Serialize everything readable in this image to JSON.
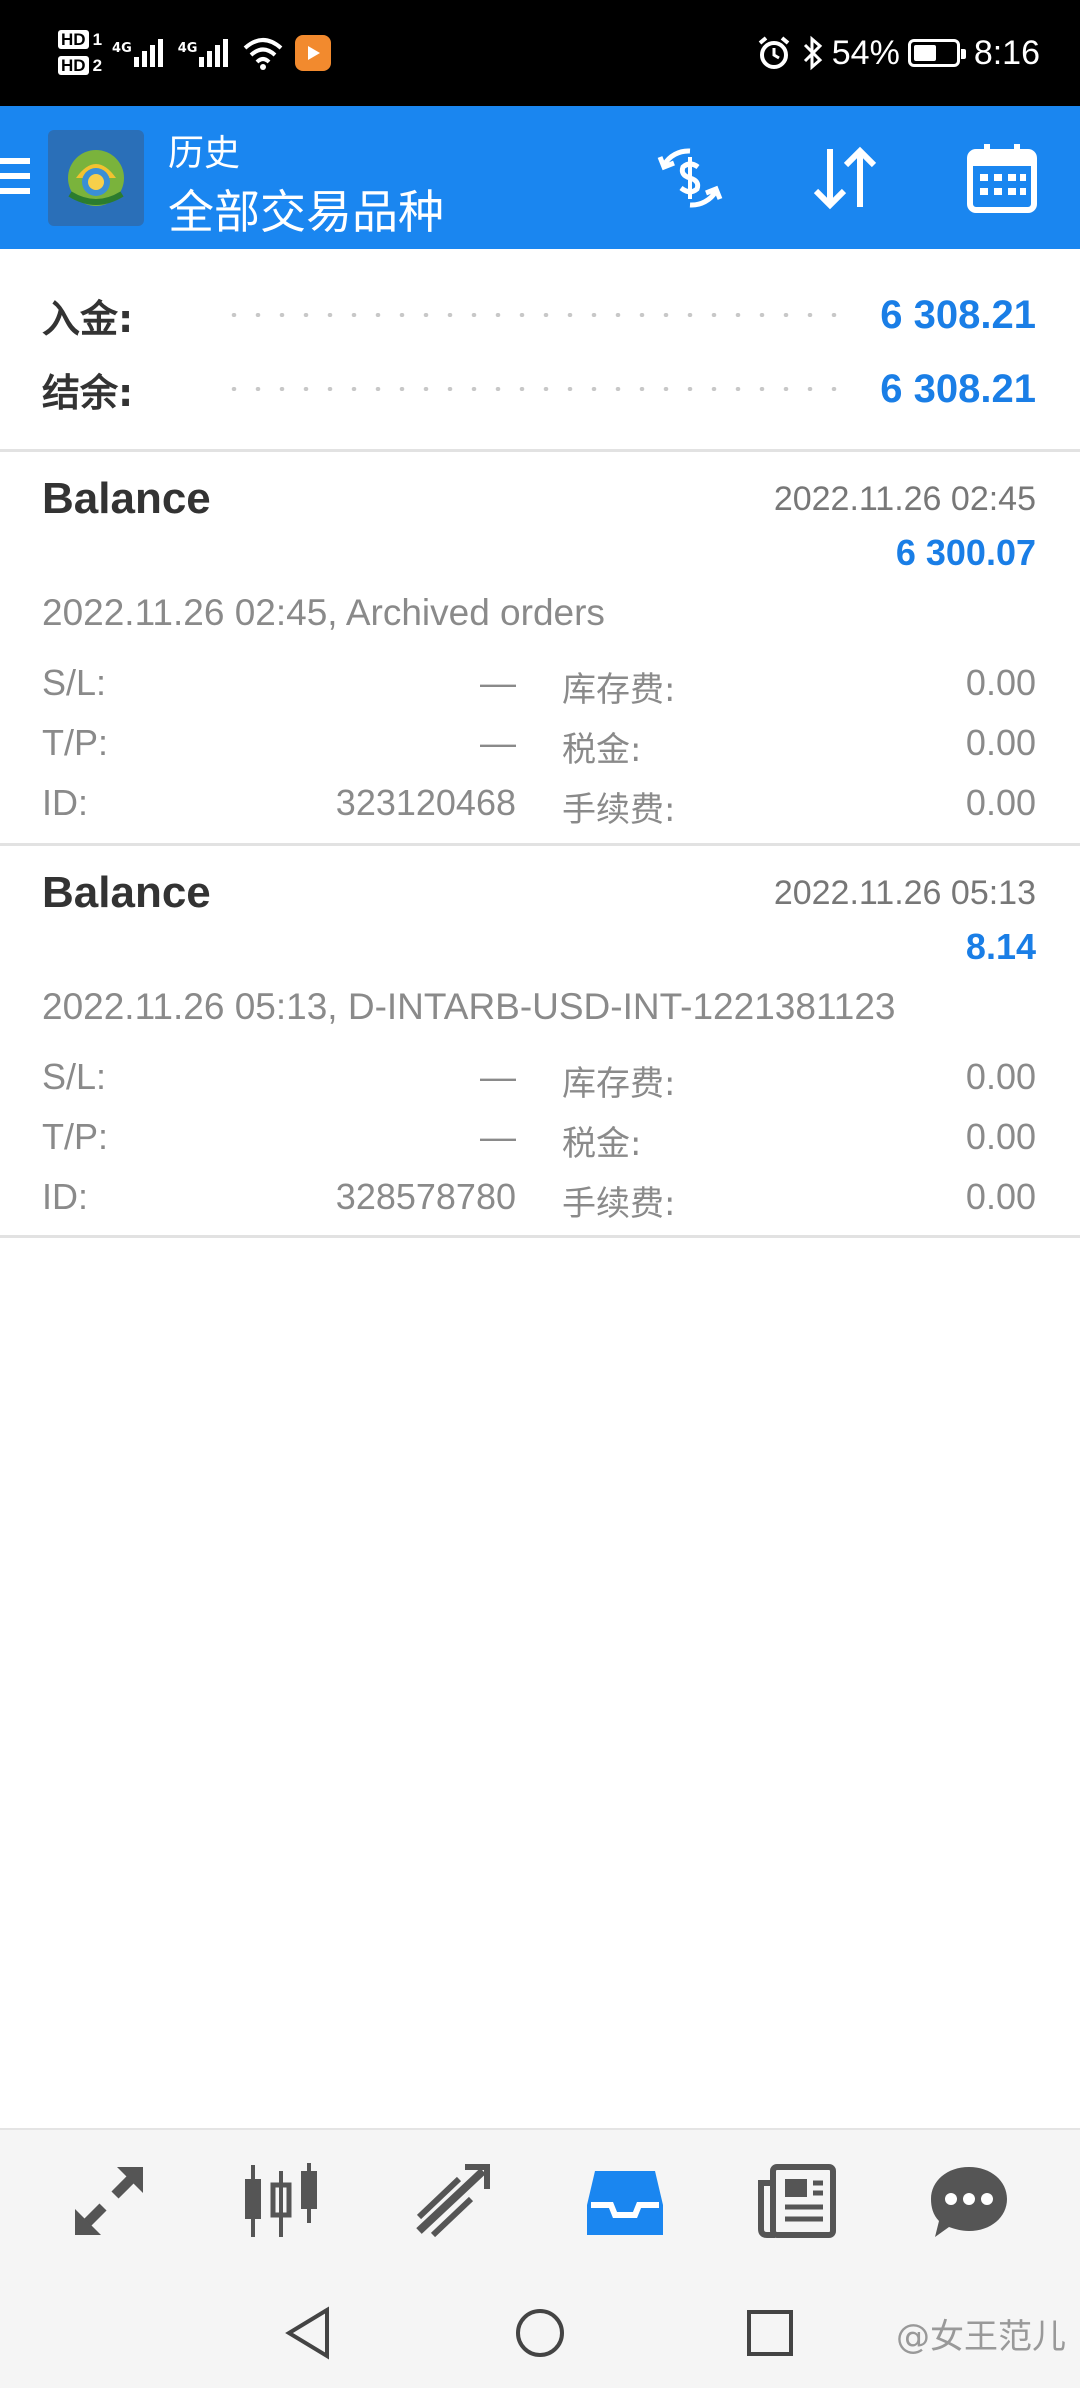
{
  "status_bar": {
    "hd1": "HD",
    "hd1_sim": "1",
    "hd2": "HD",
    "hd2_sim": "2",
    "sig1_label": "4G",
    "sig2_label": "4G",
    "battery_text": "54%",
    "battery_level": 0.54,
    "time": "8:16"
  },
  "header": {
    "subtitle": "历史",
    "title": "全部交易品种",
    "accent": "#1a86f0"
  },
  "summary": {
    "deposit_label": "入金:",
    "deposit_value": "6 308.21",
    "balance_label": "结余:",
    "balance_value": "6 308.21"
  },
  "deals": [
    {
      "type": "Balance",
      "time": "2022.11.26 02:45",
      "amount": "6 300.07",
      "comment": "2022.11.26 02:45, Archived orders",
      "sl_label": "S/L:",
      "sl_value": "—",
      "tp_label": "T/P:",
      "tp_value": "—",
      "id_label": "ID:",
      "id_value": "323120468",
      "swap_label": "库存费:",
      "swap_value": "0.00",
      "tax_label": "税金:",
      "tax_value": "0.00",
      "fee_label": "手续费:",
      "fee_value": "0.00"
    },
    {
      "type": "Balance",
      "time": "2022.11.26 05:13",
      "amount": "8.14",
      "comment": "2022.11.26 05:13, D-INTARB-USD-INT-1221381123",
      "sl_label": "S/L:",
      "sl_value": "—",
      "tp_label": "T/P:",
      "tp_value": "—",
      "id_label": "ID:",
      "id_value": "328578780",
      "swap_label": "库存费:",
      "swap_value": "0.00",
      "tax_label": "税金:",
      "tax_value": "0.00",
      "fee_label": "手续费:",
      "fee_value": "0.00"
    }
  ],
  "bottom_nav": {
    "items": [
      "quotes-icon",
      "chart-icon",
      "trade-icon",
      "history-icon",
      "news-icon",
      "chat-icon"
    ],
    "active": "history-icon",
    "active_color": "#1a86f0",
    "inactive_color": "#555555"
  },
  "watermark": "@女王范儿"
}
